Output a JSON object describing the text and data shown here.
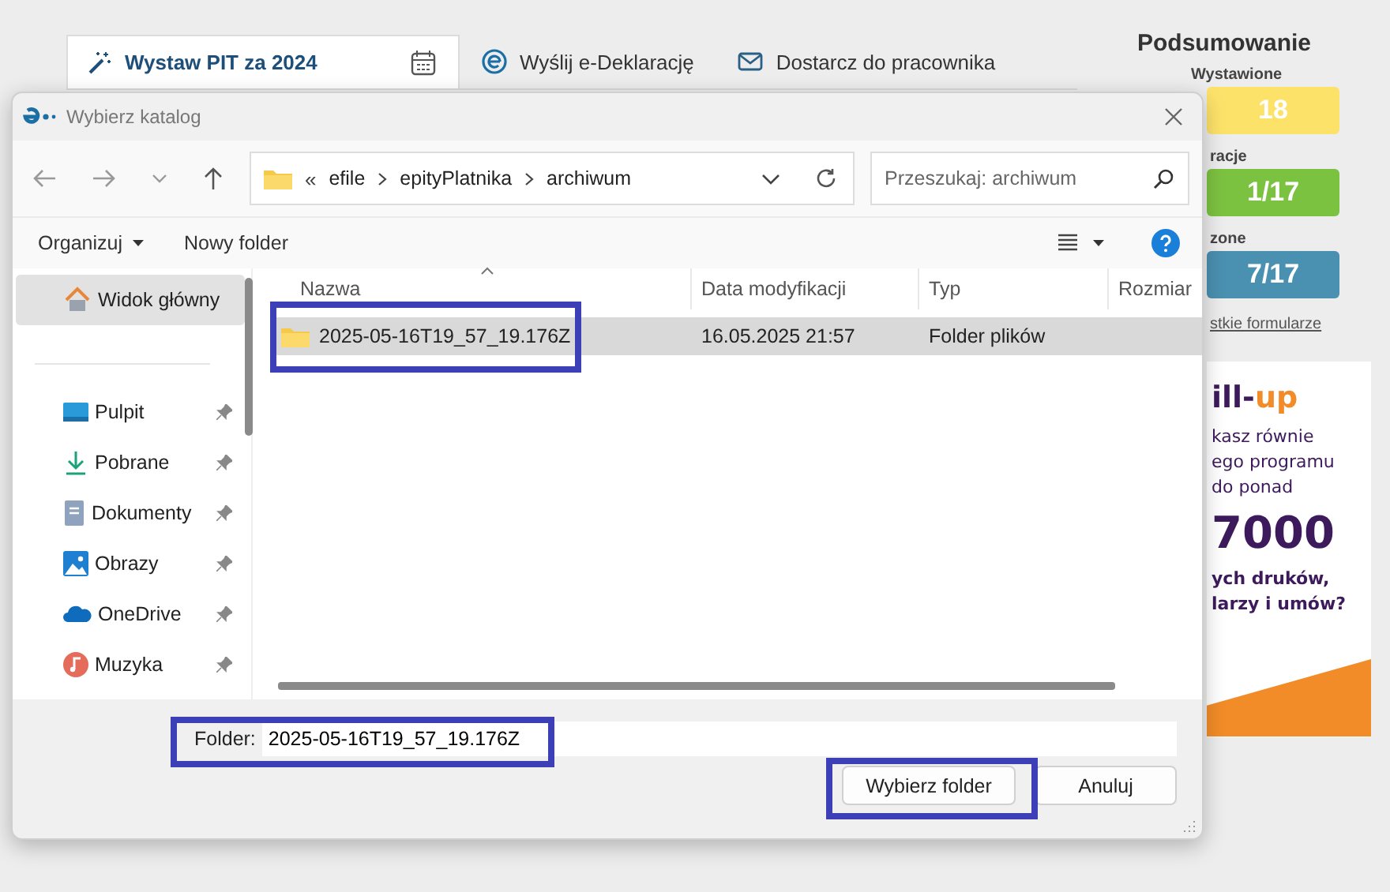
{
  "app_tabs": [
    {
      "label": "Wystaw PIT za 2024",
      "selected": true
    },
    {
      "label": "Wyślij e-Deklarację",
      "selected": false
    },
    {
      "label": "Dostarcz do pracownika",
      "selected": false
    }
  ],
  "summary": {
    "title": "Podsumowanie",
    "stats": [
      {
        "label": "Wystawione",
        "value": "18",
        "color": "#fde26a"
      },
      {
        "label": "racje",
        "value": "1/17",
        "color": "#7cc241"
      },
      {
        "label": "zone",
        "value": "7/17",
        "color": "#4a90b0"
      }
    ],
    "link": "stkie formularze"
  },
  "ad": {
    "logo_dark": "ill-",
    "logo_accent": "up",
    "lines": [
      "kasz równie",
      "ego programu",
      "do ponad"
    ],
    "number": "7000",
    "tail": [
      "ych druków,",
      "larzy i umów?"
    ]
  },
  "dialog": {
    "title": "Wybierz katalog",
    "breadcrumb_overflow": "«",
    "breadcrumb": [
      "efile",
      "epityPlatnika",
      "archiwum"
    ],
    "search": {
      "placeholder": "Przeszukaj: archiwum"
    },
    "toolbar": [
      "Organizuj",
      "Nowy folder"
    ],
    "sidebar": [
      {
        "label": "Widok główny",
        "selected": true,
        "pinned": false
      },
      {
        "label": "Pulpit",
        "selected": false,
        "pinned": true
      },
      {
        "label": "Pobrane",
        "selected": false,
        "pinned": true
      },
      {
        "label": "Dokumenty",
        "selected": false,
        "pinned": true
      },
      {
        "label": "Obrazy",
        "selected": false,
        "pinned": true
      },
      {
        "label": "OneDrive",
        "selected": false,
        "pinned": true
      },
      {
        "label": "Muzyka",
        "selected": false,
        "pinned": true
      }
    ],
    "columns": [
      "Nazwa",
      "Data modyfikacji",
      "Typ",
      "Rozmiar"
    ],
    "rows": [
      {
        "name": "2025-05-16T19_57_19.176Z",
        "modified": "16.05.2025 21:57",
        "type": "Folder plików",
        "selected": true,
        "highlighted": true
      }
    ],
    "folder_field": {
      "label": "Folder:",
      "value": "2025-05-16T19_57_19.176Z",
      "highlighted": true
    },
    "buttons": [
      {
        "label": "Wybierz folder",
        "highlighted": true
      },
      {
        "label": "Anuluj",
        "highlighted": false
      }
    ]
  }
}
